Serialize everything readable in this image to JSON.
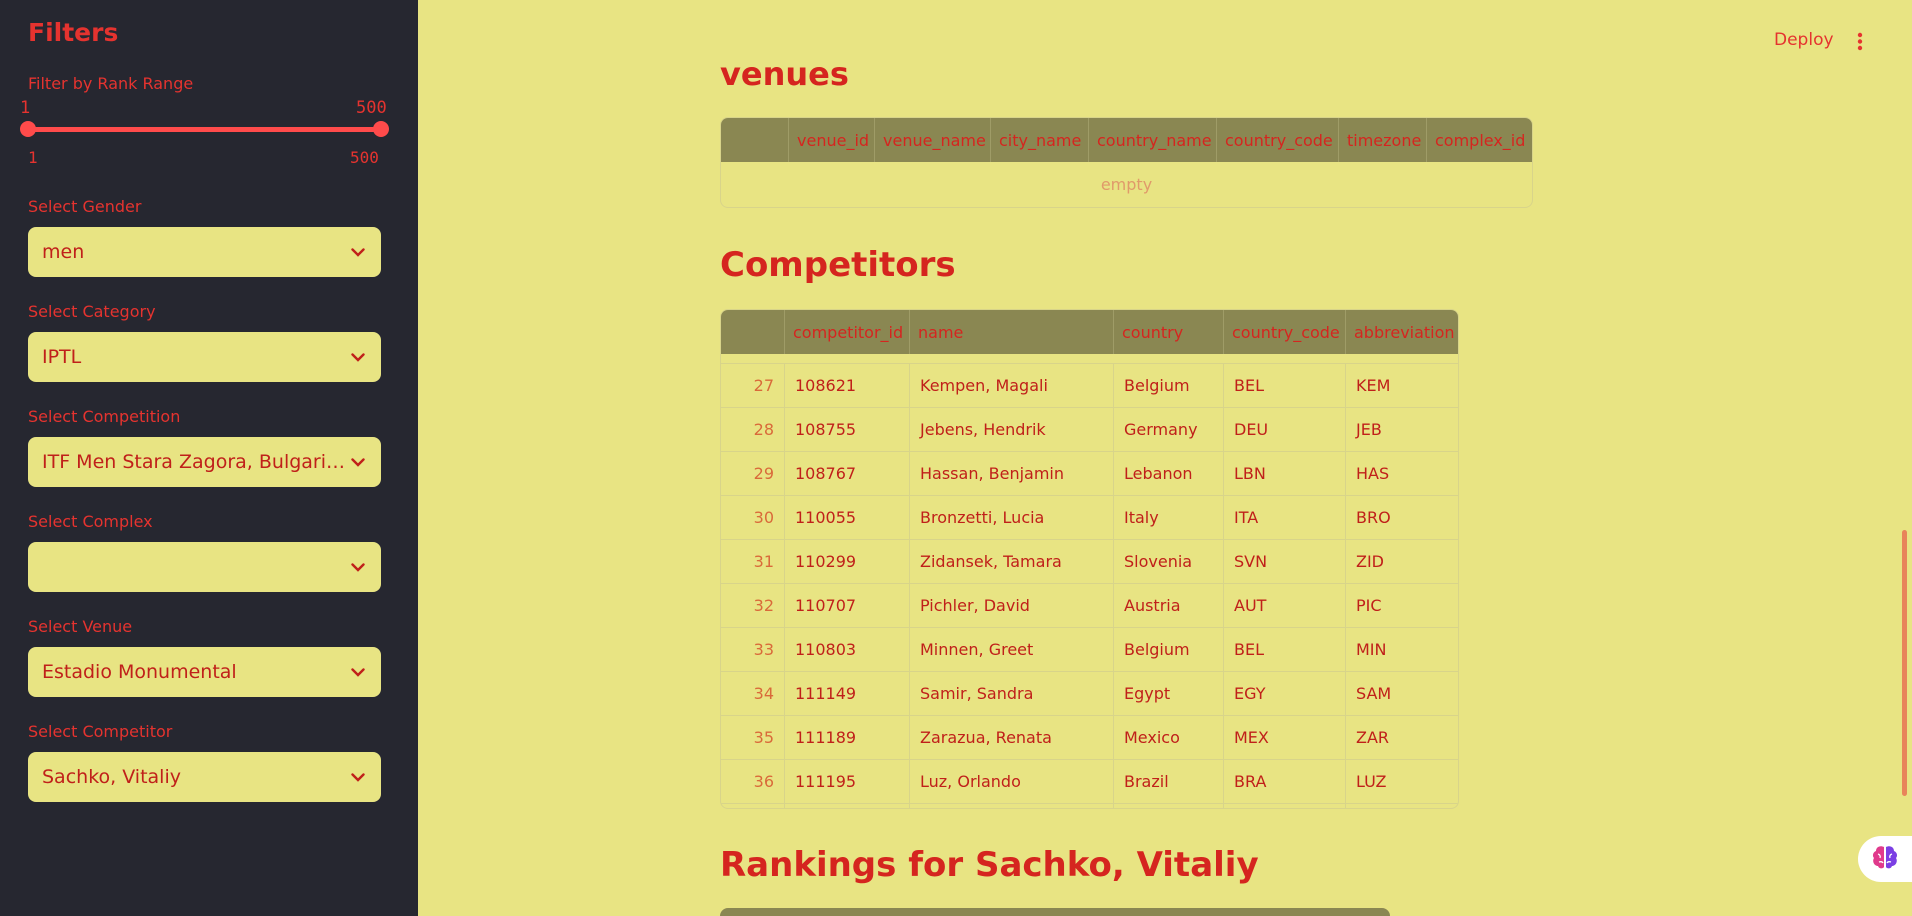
{
  "header": {
    "deploy_label": "Deploy"
  },
  "sidebar": {
    "title": "Filters",
    "rank_slider": {
      "label": "Filter by Rank Range",
      "min": "1",
      "max": "500",
      "value_low": "1",
      "value_high": "500"
    },
    "selects": [
      {
        "label": "Select Gender",
        "value": "men"
      },
      {
        "label": "Select Category",
        "value": "IPTL"
      },
      {
        "label": "Select Competition",
        "value": "ITF Men Stara Zagora, Bulgaria Men Singles"
      },
      {
        "label": "Select Complex",
        "value": ""
      },
      {
        "label": "Select Venue",
        "value": "Estadio Monumental"
      },
      {
        "label": "Select Competitor",
        "value": "Sachko, Vitaliy"
      }
    ]
  },
  "venues": {
    "title": "venues",
    "columns": [
      "",
      "venue_id",
      "venue_name",
      "city_name",
      "country_name",
      "country_code",
      "timezone",
      "complex_id"
    ],
    "empty_text": "empty"
  },
  "competitors": {
    "title": "Competitors",
    "columns": [
      "",
      "competitor_id",
      "name",
      "country",
      "country_code",
      "abbreviation"
    ],
    "rows": [
      [
        "27",
        "108621",
        "Kempen, Magali",
        "Belgium",
        "BEL",
        "KEM"
      ],
      [
        "28",
        "108755",
        "Jebens, Hendrik",
        "Germany",
        "DEU",
        "JEB"
      ],
      [
        "29",
        "108767",
        "Hassan, Benjamin",
        "Lebanon",
        "LBN",
        "HAS"
      ],
      [
        "30",
        "110055",
        "Bronzetti, Lucia",
        "Italy",
        "ITA",
        "BRO"
      ],
      [
        "31",
        "110299",
        "Zidansek, Tamara",
        "Slovenia",
        "SVN",
        "ZID"
      ],
      [
        "32",
        "110707",
        "Pichler, David",
        "Austria",
        "AUT",
        "PIC"
      ],
      [
        "33",
        "110803",
        "Minnen, Greet",
        "Belgium",
        "BEL",
        "MIN"
      ],
      [
        "34",
        "111149",
        "Samir, Sandra",
        "Egypt",
        "EGY",
        "SAM"
      ],
      [
        "35",
        "111189",
        "Zarazua, Renata",
        "Mexico",
        "MEX",
        "ZAR"
      ],
      [
        "36",
        "111195",
        "Luz, Orlando",
        "Brazil",
        "BRA",
        "LUZ"
      ]
    ]
  },
  "rankings": {
    "title": "Rankings for Sachko, Vitaliy"
  },
  "colors": {
    "accent": "#ff4b4b",
    "text": "#d5251f",
    "background": "#e8e483",
    "sidebar": "#262730",
    "header_row": "#8a8752"
  },
  "icons": [
    "chevron-down-icon",
    "more-vertical-icon",
    "brain-icon"
  ]
}
